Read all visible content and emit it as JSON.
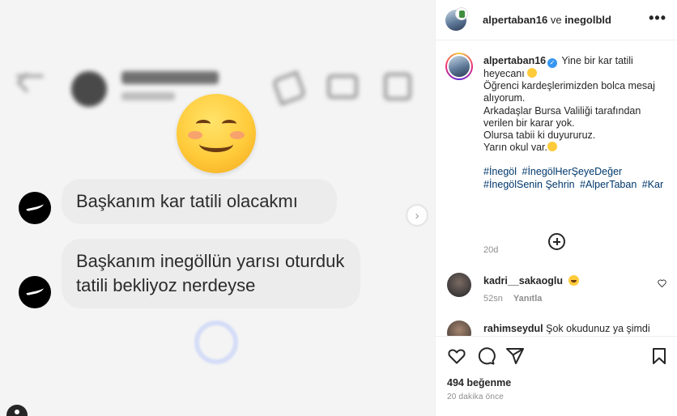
{
  "media": {
    "chat_messages": [
      {
        "text": "Başkanım kar tatili olacakmı"
      },
      {
        "text": "Başkanım inegöllün yarısı oturduk tatili bekliyoz nerdeyse"
      }
    ],
    "next_arrow": "›"
  },
  "post_header": {
    "author": "alpertaban16",
    "connector": "ve",
    "coauthor": "inegolbld",
    "more": "•••"
  },
  "caption": {
    "username": "alpertaban16",
    "verified_mark": "✓",
    "lines": [
      "Yine bir kar tatili heyecanı",
      "Öğrenci kardeşlerimizden bolca mesaj alıyorum.",
      "Arkadaşlar Bursa Valiliği tarafından verilen bir karar yok.",
      "Olursa tabii ki duyururuz.",
      "Yarın okul var."
    ],
    "hashtags": [
      "#İnegöl",
      "#İnegölHerŞeyeDeğer",
      "#İnegölSenin Şehrin",
      "#AlperTaban",
      "#Kar"
    ],
    "time": "20d"
  },
  "comments": [
    {
      "username": "kadri__sakaoglu",
      "text": "",
      "time": "52sn",
      "reply_label": "Yanıtla"
    },
    {
      "username": "rahimseydul",
      "text": "Şok okudunuz ya şimdi"
    }
  ],
  "footer": {
    "likes": "494 beğenme",
    "time": "20 dakika önce"
  },
  "colors": {
    "link": "#00376b",
    "muted": "#8e8e8e",
    "verified": "#3897f0"
  }
}
